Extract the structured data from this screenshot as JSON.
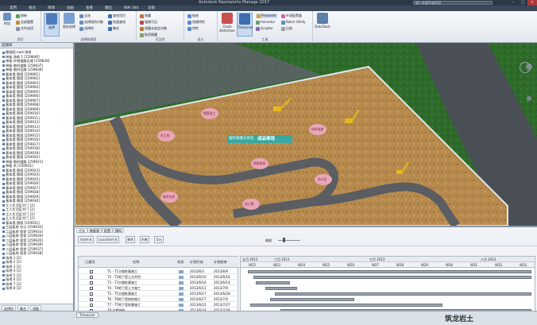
{
  "titlebar": {
    "title": "Autodesk Navisworks Manage 2017",
    "search_placeholder": "键入关键字或短语"
  },
  "menu_tabs": [
    "常用",
    "视点",
    "审阅",
    "动画",
    "查看",
    "输出",
    "BIM 360",
    "渲染"
  ],
  "ribbon": {
    "group_labels": [
      "项目",
      "选择和搜索",
      "可见性",
      "显示",
      "工具"
    ],
    "project_items": [
      "附加",
      "刷新",
      "全部重置",
      "文件选项"
    ],
    "select_items": [
      "选择",
      "保存选择",
      "全选",
      "选择相同对象",
      "选择树",
      "查找项目",
      "快速查找",
      "集合"
    ],
    "visibility_items": [
      "隐藏",
      "强制可见",
      "隐藏未选定对象",
      "取消隐藏"
    ],
    "display_items": [
      "链接",
      "快捷特性",
      "特性"
    ],
    "tool_items": [
      "Clash Detective",
      "TimeLiner",
      "Presenter",
      "Animator",
      "Scripter",
      "Batch Utility",
      "比较",
      "DataTools",
      "外观配置器",
      "Quantification"
    ]
  },
  "tree": {
    "header": "选择树",
    "rows": [
      "模拟图.nwd 场地",
      "带板 场地 1 [259846]",
      "带板 外侧道路区域 [259839]",
      "带板 临时道路 [259837]",
      "带板 临时设施 [259836]",
      "基本墙 围墙 [259901]",
      "基本墙 围墙 [259902]",
      "基本墙 围墙 [259903]",
      "基本墙 围墙 [259904]",
      "基本墙 围墙 [259905]",
      "基本墙 围墙 [259906]",
      "基本墙 围墙 [259907]",
      "基本墙 围墙 [259908]",
      "基本墙 围墙 [259909]",
      "基本墙 围墙 [259910]",
      "基本墙 围墙 [259911]",
      "基本墙 围墙 [259912]",
      "基本墙 围墙 [259913]",
      "基本墙 围墙 [259914]",
      "基本墙 围墙 [259915]",
      "基本墙 围墙 [259916]",
      "基本墙 围墙 [259917]",
      "基本墙 围墙 [259918]",
      "基本墙 围墙 [259919]",
      "基本墙 围墙 [259920]",
      "带板 临时道路 [259921]",
      "带板 木 [259922]",
      "基本墙 围墙 [259923]",
      "基本墙 围墙 [259924]",
      "基本墙 围墙 [259925]",
      "基本墙 围墙 [259926]",
      "基本墙 围墙 [259927]",
      "基本墙 围墙 [259928]",
      "基本墙 围墙 [259929]",
      "基本墙 围墙 [259930]",
      "工人生活区大门 [2]",
      "工人生活区大门 [2]",
      "工人生活区大门 [2]",
      "工人生活区大门 [2]",
      "基本墙 围墙 [259931]",
      "三层板房 办公 [259932]",
      "二层板房 宿舍 [259933]",
      "二层板房 宿舍 [259934]",
      "二层板房 宿舍 [259935]",
      "二层板房 宿舍 [259936]",
      "二层板房 宿舍 [259937]",
      "二层板房 宿舍 [259938]",
      "场地 1 [2]",
      "场地 2 [2]",
      "场地 3 [2]",
      "场地 4 [2]",
      "场地 5 [2]",
      "场地 6 [2]",
      "场地 7 [2]",
      "场地 8 [2]"
    ],
    "bottom_tabs": [
      "选择树",
      "集合",
      "测量"
    ]
  },
  "viewport": {
    "banner_label": "临时道路与绿化",
    "building_label": "成品堆场",
    "pink_labels": [
      "钢筋加工",
      "木工房",
      "材料堆放",
      "钢筋堆场",
      "办公区",
      "临时仓库",
      "加工棚"
    ]
  },
  "timeliner": {
    "tabs": [
      "任务",
      "数据源",
      "配置",
      "模拟"
    ],
    "toolbar": [
      "添加任务",
      "自动添加任务",
      "删除",
      "附着",
      "导出",
      "缩放"
    ],
    "columns": [
      "已激活",
      "名称",
      "状态",
      "计划开始",
      "计划结束"
    ],
    "tasks": [
      {
        "name": "T1 - T1主楼桩基施工",
        "start": "2013/6/3",
        "end": "2013/6/9"
      },
      {
        "name": "T2 - T2地下室土方开挖",
        "start": "2013/6/10",
        "end": "2013/6/16"
      },
      {
        "name": "T3 - T3主楼桩基施工",
        "start": "2013/6/10",
        "end": "2013/6/14"
      },
      {
        "name": "T4 - T4地下室土方施工",
        "start": "2013/6/13",
        "end": "2013/7/9"
      },
      {
        "name": "T5 - T5主楼桩基施工",
        "start": "2013/6/17",
        "end": "2013/6/28"
      },
      {
        "name": "T6 - T6地下室结构施工",
        "start": "2013/6/17",
        "end": "2013/7/4"
      },
      {
        "name": "T7 - T7地下室地基施工",
        "start": "2013/6/23",
        "end": "2013/7/27"
      },
      {
        "name": "T8 主楼结构",
        "start": "2013/6/24",
        "end": "2013/7/29"
      }
    ],
    "months": [
      "五月 2013",
      "六月 2013",
      "七月 2013",
      "八月 2013"
    ],
    "weeks": [
      "W22",
      "W23",
      "W24",
      "W25",
      "W26",
      "W27",
      "W28",
      "W29",
      "W30",
      "W31",
      "W32",
      "W33"
    ],
    "bars": [
      {
        "start_week": 0.3,
        "end_week": 11.8
      },
      {
        "start_week": 0.5,
        "end_week": 11.8
      },
      {
        "start_week": 0.6,
        "end_week": 2.0
      },
      {
        "start_week": 1.0,
        "end_week": 2.3
      },
      {
        "start_week": 1.4,
        "end_week": 11.8
      },
      {
        "start_week": 1.2,
        "end_week": 4.6
      },
      {
        "start_week": 0.4,
        "end_week": 8.2
      },
      {
        "start_week": 1.6,
        "end_week": 11.8
      }
    ]
  },
  "status": {
    "timeliner_tab": "TimeLiner",
    "watermark": "筑龙岩土"
  }
}
